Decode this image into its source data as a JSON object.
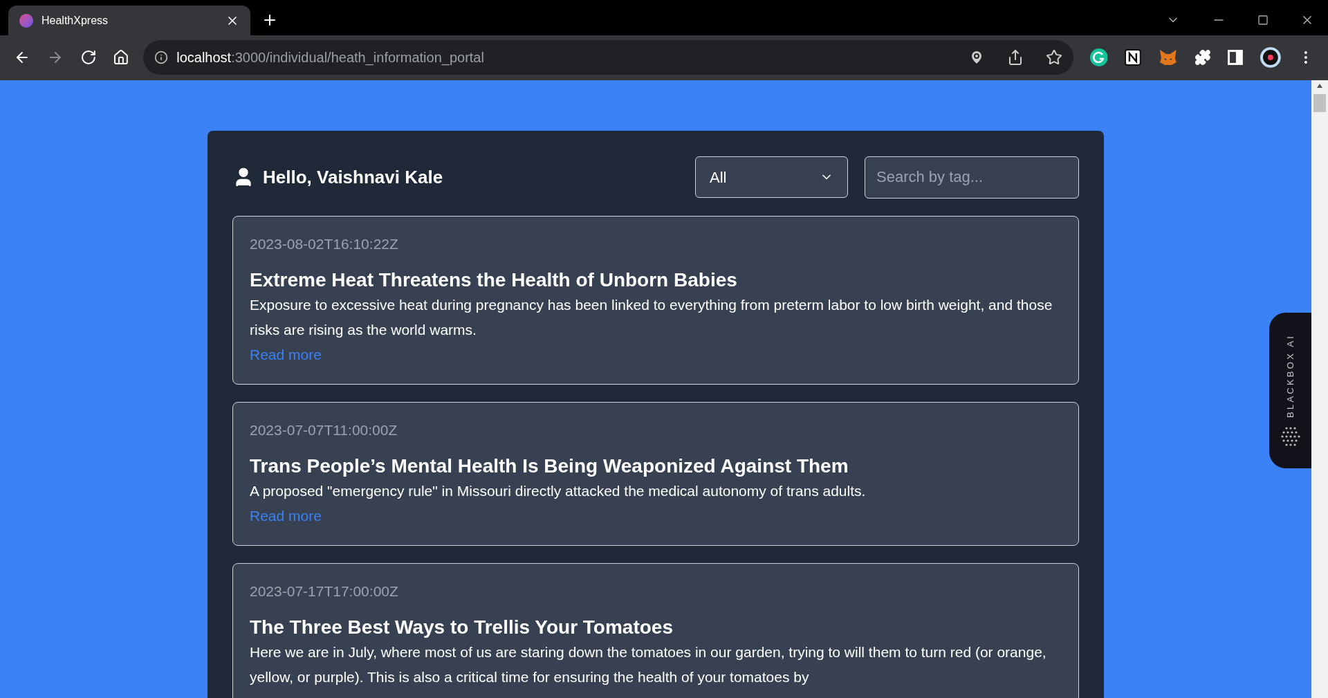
{
  "browser": {
    "tab_title": "HealthXpress",
    "url_host": "localhost",
    "url_path": ":3000/individual/heath_information_portal"
  },
  "header": {
    "greeting": "Hello, Vaishnavi Kale",
    "filter": {
      "value": "All"
    },
    "search": {
      "placeholder": "Search by tag..."
    }
  },
  "articles": [
    {
      "date": "2023-08-02T16:10:22Z",
      "title": "Extreme Heat Threatens the Health of Unborn Babies",
      "summary": "Exposure to excessive heat during pregnancy has been linked to everything from preterm labor to low birth weight, and those risks are rising as the world warms.",
      "link": "Read more"
    },
    {
      "date": "2023-07-07T11:00:00Z",
      "title": "Trans People’s Mental Health Is Being Weaponized Against Them",
      "summary": "A proposed \"emergency rule\" in Missouri directly attacked the medical autonomy of trans adults.",
      "link": "Read more"
    },
    {
      "date": "2023-07-17T17:00:00Z",
      "title": "The Three Best Ways to Trellis Your Tomatoes",
      "summary": "Here we are in July, where most of us are staring down the tomatoes in our garden, trying to will them to turn red (or orange, yellow, or purple). This is also a critical time for ensuring the health of your tomatoes by"
    }
  ],
  "side_widget": {
    "label": "BLACKBOX AI"
  }
}
